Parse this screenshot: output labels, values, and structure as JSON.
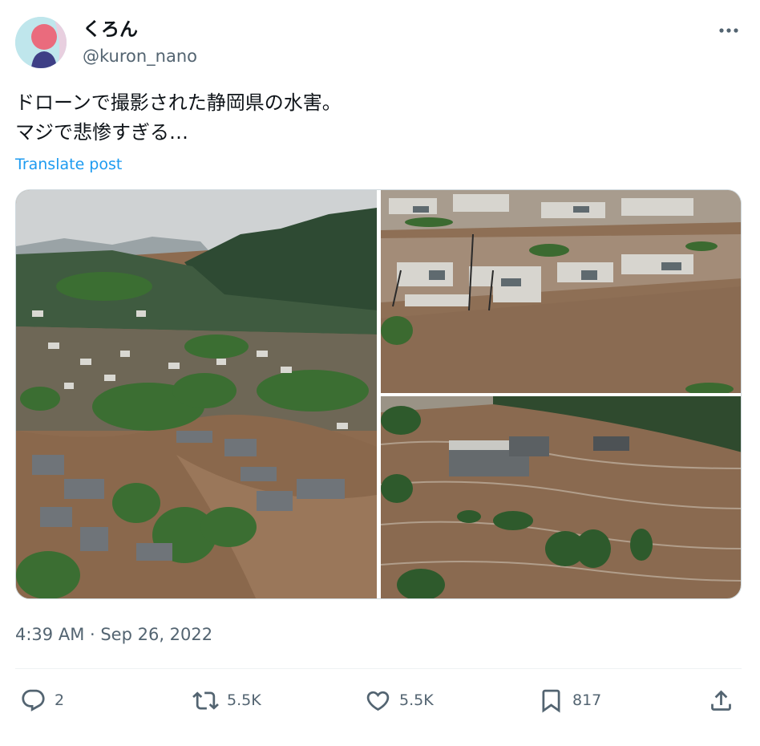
{
  "author": {
    "display_name": "くろん",
    "handle": "@kuron_nano"
  },
  "post": {
    "line1": "ドローンで撮影された静岡県の水害。",
    "line2": "マジで悲惨すぎる…",
    "translate_label": "Translate post",
    "timestamp": "4:39 AM · Sep 26, 2022"
  },
  "media": {
    "count": 3,
    "colors": {
      "water": "#8c6a4e",
      "foliage": "#2f6b2d",
      "roof": "#6b7176",
      "sky": "#c9ccce"
    }
  },
  "actions": {
    "replies": "2",
    "retweets": "5.5K",
    "likes": "5.5K",
    "bookmarks": "817"
  },
  "icons": {
    "more": "more-horizontal-icon",
    "reply": "reply-bubble-icon",
    "retweet": "retweet-icon",
    "like": "heart-icon",
    "bookmark": "bookmark-icon",
    "share": "share-upload-icon"
  },
  "colors": {
    "text": "#0f1419",
    "secondary": "#536471",
    "link": "#1d9bf0",
    "divider": "#eff3f4"
  }
}
